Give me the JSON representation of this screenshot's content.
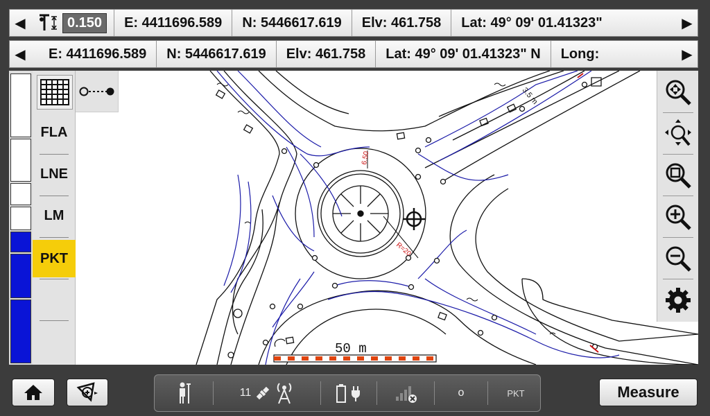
{
  "top_bar": {
    "left_arrow": "◀",
    "right_arrow": "▶",
    "height_value": "0.150",
    "items": [
      "E: 4411696.589",
      "N: 5446617.619",
      "Elv: 461.758",
      "Lat: 49° 09' 01.41323\""
    ]
  },
  "second_bar": {
    "left_arrow": "◀",
    "right_arrow": "▶",
    "items": [
      "E: 4411696.589",
      "N: 5446617.619",
      "Elv: 461.758",
      "Lat: 49° 09' 01.41323\" N",
      "Long:"
    ]
  },
  "left_panel": {
    "codes": [
      {
        "label": "FLA",
        "active": false
      },
      {
        "label": "LNE",
        "active": false
      },
      {
        "label": "LM",
        "active": false
      },
      {
        "label": "PKT",
        "active": true
      },
      {
        "label": "",
        "active": false
      }
    ],
    "layer_colors": [
      "#ffffff",
      "#ffffff",
      "#ffffff",
      "#ffffff",
      "#0a14d6",
      "#0a14d6",
      "#0a14d6"
    ]
  },
  "map": {
    "scale_label": "50 m",
    "dim_label": "6.50",
    "radius_label": "R=20",
    "side_label": "3.5 m"
  },
  "right_tools": [
    "zoom-extents-icon",
    "pan-icon",
    "zoom-window-icon",
    "zoom-in-icon",
    "zoom-out-icon",
    "settings-icon"
  ],
  "bottom": {
    "satellite_count": "11",
    "point_mode": "o",
    "current_code": "PKT",
    "measure_label": "Measure"
  },
  "colors": {
    "accent": "#f5cd0a",
    "blue_line": "#1a1aa8",
    "red_text": "#cc1111"
  }
}
